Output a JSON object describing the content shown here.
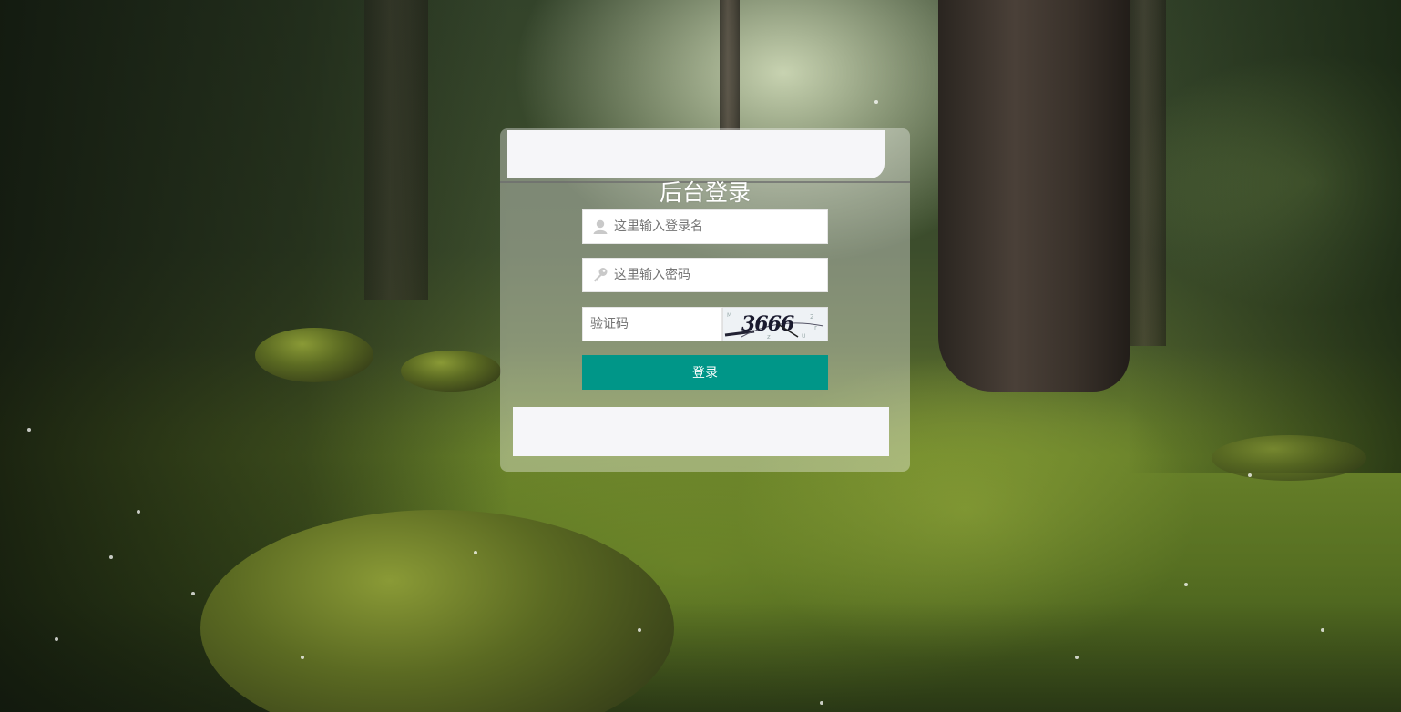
{
  "login": {
    "title": "后台登录",
    "username_placeholder": "这里输入登录名",
    "password_placeholder": "这里输入密码",
    "captcha_placeholder": "验证码",
    "captcha_code": "3666",
    "submit_label": "登录",
    "icons": {
      "user": "user-icon",
      "password": "key-icon"
    },
    "button_color": "#009688"
  }
}
